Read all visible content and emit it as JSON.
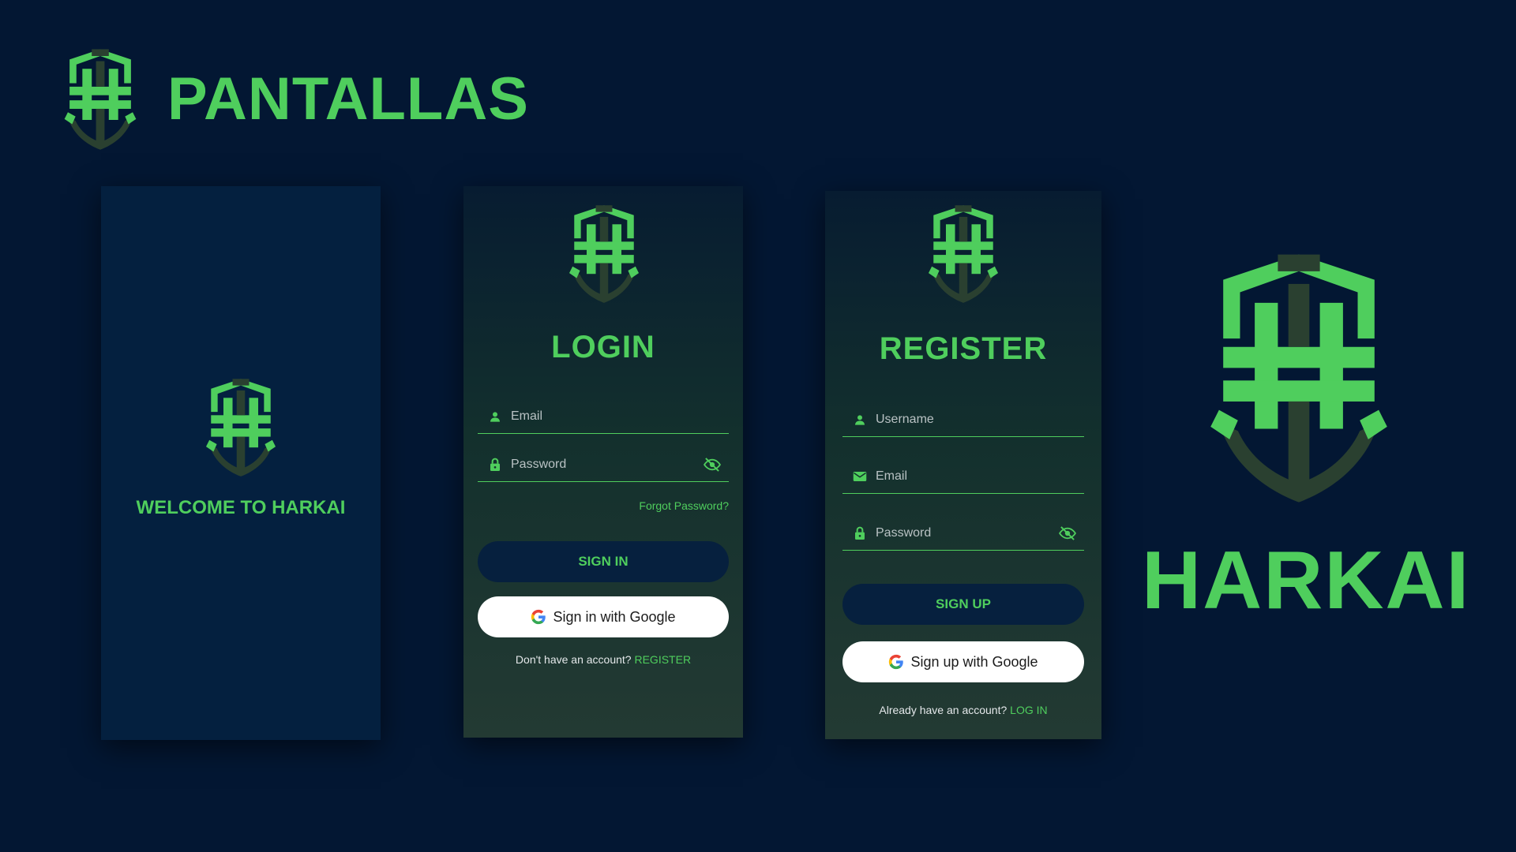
{
  "header": {
    "title": "PANTALLAS",
    "logo_icon": "harkai-shield-logo"
  },
  "welcome": {
    "text": "WELCOME TO HARKAI",
    "logo_icon": "harkai-shield-logo"
  },
  "login": {
    "title": "LOGIN",
    "email_placeholder": "Email",
    "password_placeholder": "Password",
    "forgot_label": "Forgot Password?",
    "signin_label": "SIGN IN",
    "google_label": "Sign in with Google",
    "footer_text": "Don't have an account?",
    "footer_link": "REGISTER"
  },
  "register": {
    "title": "REGISTER",
    "username_placeholder": "Username",
    "email_placeholder": "Email",
    "password_placeholder": "Password",
    "signup_label": "SIGN UP",
    "google_label": "Sign up with Google",
    "footer_text": "Already have an account?",
    "footer_link": "LOG IN"
  },
  "brand": {
    "name": "HARKAI"
  },
  "colors": {
    "accent": "#4fce5d",
    "background": "#031733",
    "dark_button": "#06203e",
    "logo_dark": "#2a4030"
  }
}
